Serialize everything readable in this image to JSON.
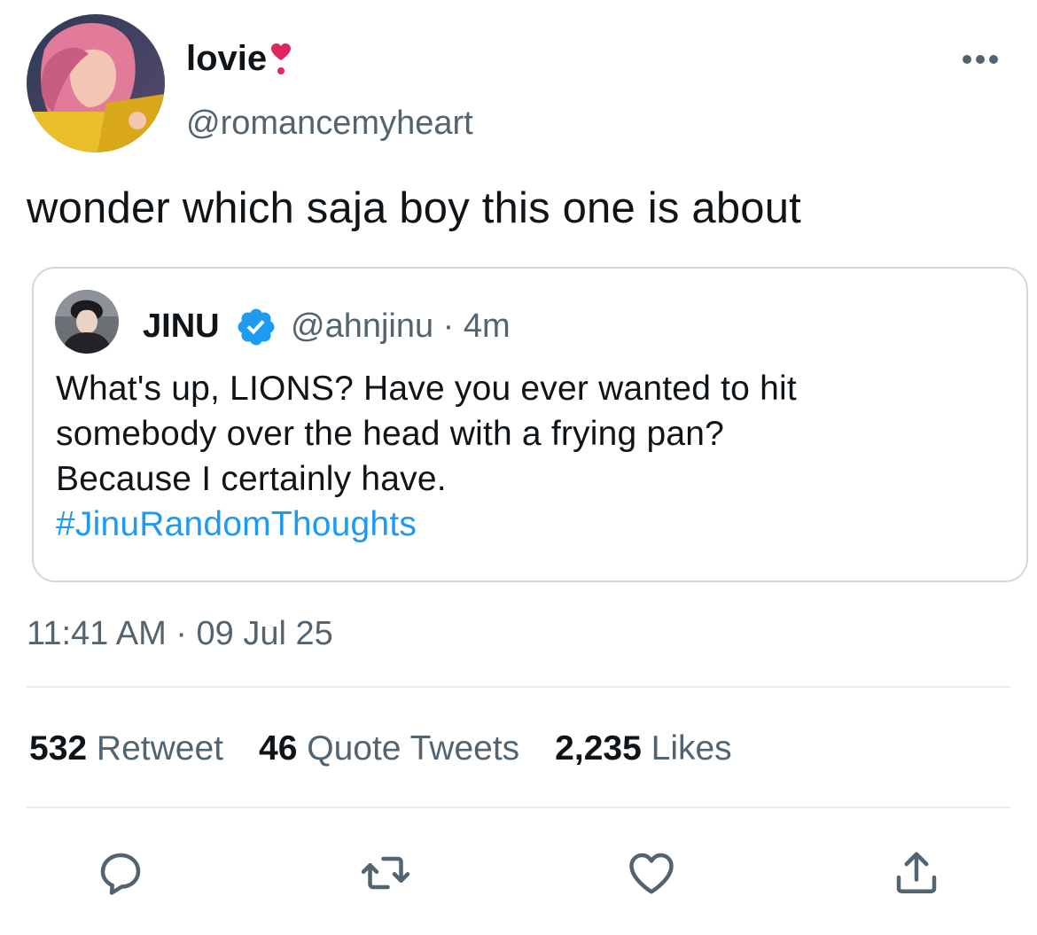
{
  "tweet": {
    "display_name": "lovie",
    "handle": "@romancemyheart",
    "text": "wonder which saja boy this one is about",
    "timestamp": "11:41 AM · 09 Jul 25",
    "avatar_icon": "profile-avatar",
    "name_emoji": "heart-exclamation-icon"
  },
  "quoted": {
    "name": "JINU",
    "verified_icon": "verified-badge-icon",
    "handle_time": "@ahnjinu · 4m",
    "lines": [
      "What's up, LIONS? Have you ever wanted to hit",
      "somebody over the head with a frying pan?",
      "Because I certainly have."
    ],
    "hashtag": "#JinuRandomThoughts"
  },
  "stats": {
    "retweets_count": "532",
    "retweets_label": "Retweet",
    "quotes_count": "46",
    "quotes_label": "Quote Tweets",
    "likes_count": "2,235",
    "likes_label": "Likes"
  },
  "actions": [
    "reply-icon",
    "retweet-icon",
    "like-icon",
    "share-icon"
  ],
  "colors": {
    "accent": "#1d9bf0",
    "secondary_text": "#536471",
    "heart": "#e0245e"
  }
}
